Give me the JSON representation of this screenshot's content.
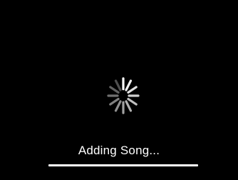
{
  "status": {
    "label": "Adding Song..."
  },
  "spinner": {
    "icon": "activity-spinner-icon",
    "color": "#ffffff"
  },
  "progress": {
    "fraction": 1.0,
    "fill_color": "#ffffff",
    "track_color": "#3a3a3a"
  },
  "colors": {
    "background": "#000000"
  }
}
